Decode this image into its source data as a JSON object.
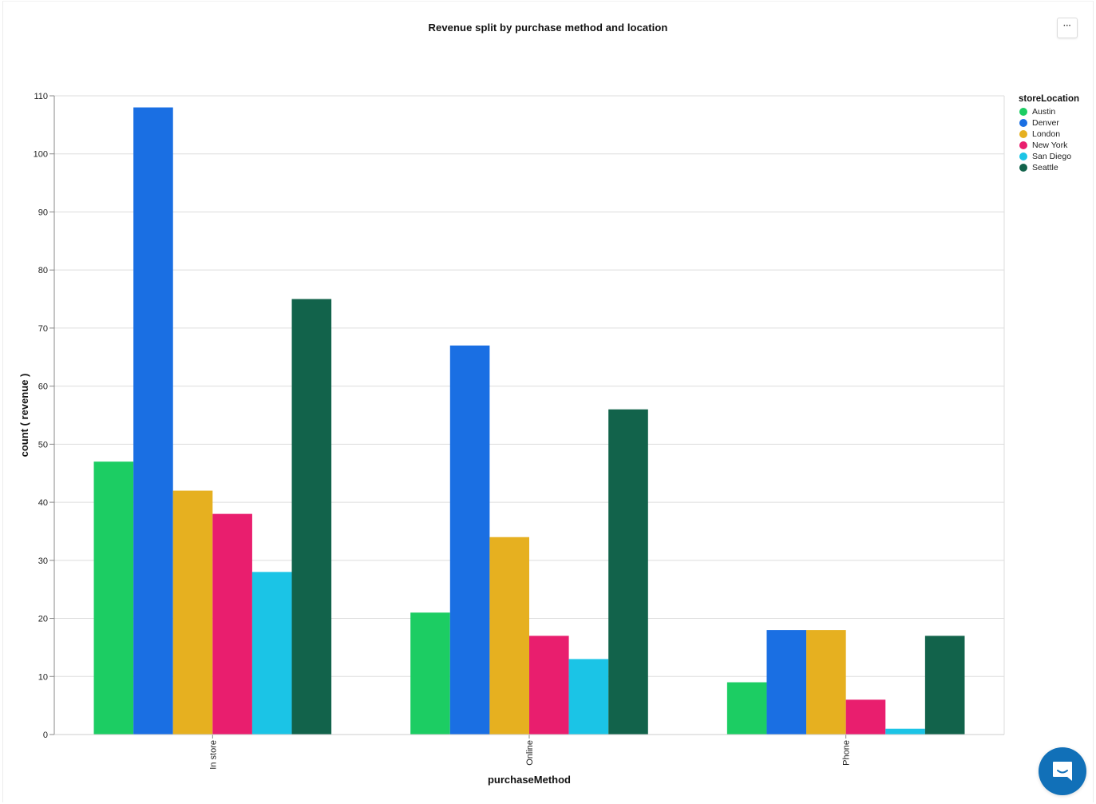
{
  "header": {
    "title": "Revenue split by purchase method and location",
    "more_button_label": "···",
    "more_icon": "ellipsis-icon"
  },
  "legend": {
    "title": "storeLocation",
    "items": [
      {
        "label": "Austin",
        "color": "#1ccd63"
      },
      {
        "label": "Denver",
        "color": "#1a6fe3"
      },
      {
        "label": "London",
        "color": "#e6b020"
      },
      {
        "label": "New York",
        "color": "#e91e6e"
      },
      {
        "label": "San Diego",
        "color": "#1bc4e6"
      },
      {
        "label": "Seattle",
        "color": "#12634b"
      }
    ]
  },
  "chat_widget": {
    "icon": "chat-bubble-icon",
    "color": "#1170b8"
  },
  "chart_data": {
    "type": "bar",
    "title": "Revenue split by purchase method and location",
    "xlabel": "purchaseMethod",
    "ylabel": "count ( revenue )",
    "categories": [
      "In store",
      "Online",
      "Phone"
    ],
    "ylim": [
      0,
      110
    ],
    "yticks": [
      0,
      10,
      20,
      30,
      40,
      50,
      60,
      70,
      80,
      90,
      100,
      110
    ],
    "grid": true,
    "legend_position": "top-right",
    "legend_title": "storeLocation",
    "series": [
      {
        "name": "Austin",
        "color": "#1ccd63",
        "values": [
          47,
          21,
          9
        ]
      },
      {
        "name": "Denver",
        "color": "#1a6fe3",
        "values": [
          108,
          67,
          18
        ]
      },
      {
        "name": "London",
        "color": "#e6b020",
        "values": [
          42,
          34,
          18
        ]
      },
      {
        "name": "New York",
        "color": "#e91e6e",
        "values": [
          38,
          17,
          6
        ]
      },
      {
        "name": "San Diego",
        "color": "#1bc4e6",
        "values": [
          28,
          13,
          1
        ]
      },
      {
        "name": "Seattle",
        "color": "#12634b",
        "values": [
          75,
          56,
          17
        ]
      }
    ]
  }
}
